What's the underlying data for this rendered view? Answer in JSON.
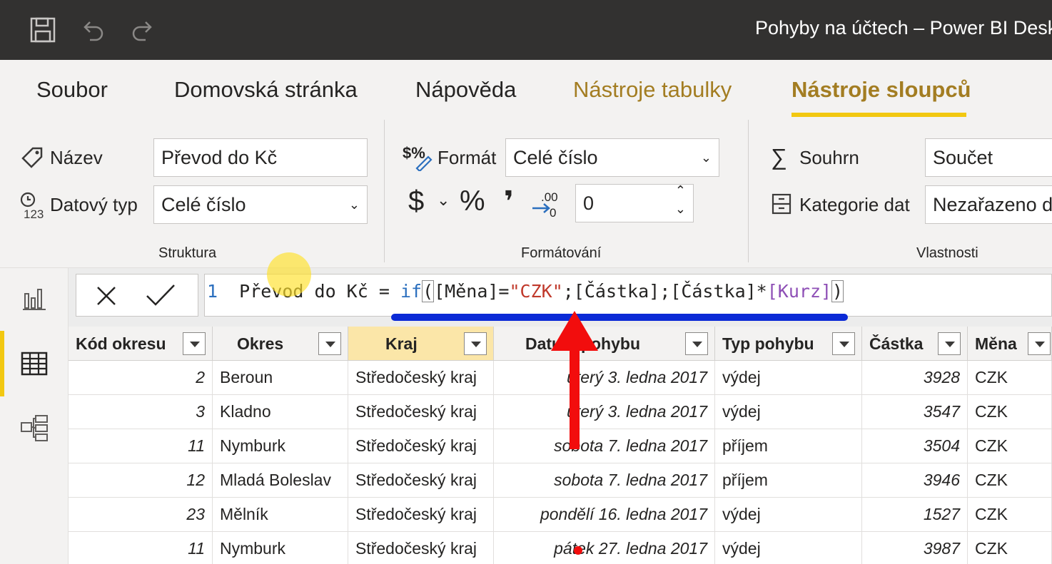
{
  "window": {
    "title": "Pohyby na účtech – Power BI Desk"
  },
  "quick_access": {
    "save": "save-icon",
    "undo": "undo-icon",
    "redo": "redo-icon"
  },
  "ribbon_tabs": [
    {
      "label": "Soubor"
    },
    {
      "label": "Domovská stránka"
    },
    {
      "label": "Nápověda"
    },
    {
      "label": "Nástroje tabulky"
    },
    {
      "label": "Nástroje sloupců"
    }
  ],
  "structure": {
    "group_label": "Struktura",
    "name_label": "Název",
    "name_value": "Převod do Kč",
    "datatype_label": "Datový typ",
    "datatype_value": "Celé číslo"
  },
  "formatting": {
    "group_label": "Formátování",
    "format_label": "Formát",
    "format_value": "Celé číslo",
    "currency_symbol": "$",
    "percent_symbol": "%",
    "comma_symbol": "❜",
    "decimals_value": "0"
  },
  "properties": {
    "group_label": "Vlastnosti",
    "summary_label": "Souhrn",
    "summary_value": "Součet",
    "category_label": "Kategorie dat",
    "category_value": "Nezařazeno d"
  },
  "formula": {
    "line_number": "1",
    "column_name": "Převod do Kč",
    "eq": " = ",
    "fn": "if",
    "open": "(",
    "part1": "[Měna]=",
    "str": "\"CZK\"",
    "part2": ";[Částka];[Částka]*",
    "meas": "[Kurz]",
    "close": ")"
  },
  "table": {
    "columns": [
      "Kód okresu",
      "Okres",
      "Kraj",
      "Datum pohybu",
      "Typ pohybu",
      "Částka",
      "Měna"
    ],
    "rows": [
      [
        "2",
        "Beroun",
        "Středočeský kraj",
        "úterý 3. ledna 2017",
        "výdej",
        "3928",
        "CZK"
      ],
      [
        "3",
        "Kladno",
        "Středočeský kraj",
        "úterý 3. ledna 2017",
        "výdej",
        "3547",
        "CZK"
      ],
      [
        "11",
        "Nymburk",
        "Středočeský kraj",
        "sobota 7. ledna 2017",
        "příjem",
        "3504",
        "CZK"
      ],
      [
        "12",
        "Mladá Boleslav",
        "Středočeský kraj",
        "sobota 7. ledna 2017",
        "příjem",
        "3946",
        "CZK"
      ],
      [
        "23",
        "Mělník",
        "Středočeský kraj",
        "pondělí 16. ledna 2017",
        "výdej",
        "1527",
        "CZK"
      ],
      [
        "11",
        "Nymburk",
        "Středočeský kraj",
        "pátek 27. ledna 2017",
        "výdej",
        "3987",
        "CZK"
      ]
    ]
  },
  "annotation_colors": {
    "underline": "#0b2ad6",
    "arrow": "#f20d0d",
    "cursor": "#ffe028"
  }
}
